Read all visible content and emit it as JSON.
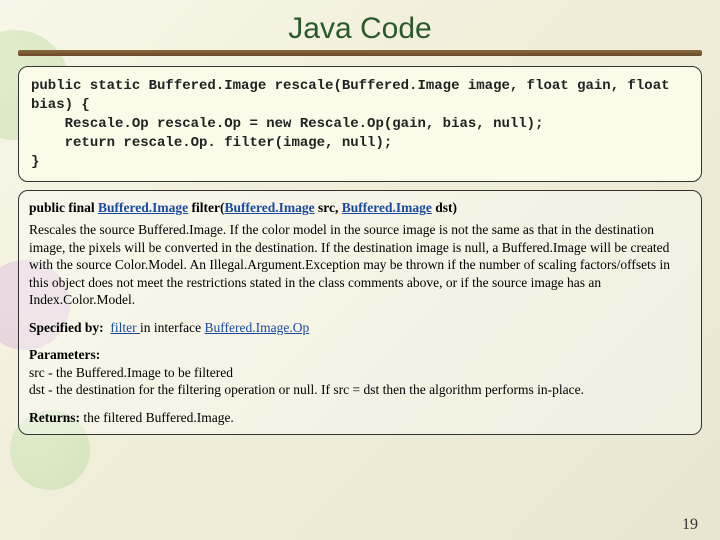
{
  "title": "Java Code",
  "code": "public static Buffered.Image rescale(Buffered.Image image, float gain, float bias) {\n    Rescale.Op rescale.Op = new Rescale.Op(gain, bias, null);\n    return rescale.Op. filter(image, null);\n}",
  "doc": {
    "sig_prefix": "public final ",
    "sig_ret": "Buffered.Image",
    "sig_mid": " filter(",
    "sig_arg1_type": "Buffered.Image",
    "sig_arg1_name": " src, ",
    "sig_arg2_type": "Buffered.Image",
    "sig_arg2_name": " dst)",
    "desc": "Rescales the source Buffered.Image. If the color model in the source image is not the same as that in the destination image, the pixels will be converted in the destination. If the destination image is null, a Buffered.Image will be created with the source Color.Model. An Illegal.Argument.Exception may be thrown if the number of scaling factors/offsets in this object does not meet the restrictions stated in the class comments above, or if the source image has an Index.Color.Model.",
    "specified_label": "Specified by:",
    "specified_link1": "filter ",
    "specified_text": "in interface ",
    "specified_link2": "Buffered.Image.Op",
    "params_label": "Parameters:",
    "param1": "src - the Buffered.Image to be filtered",
    "param2": "dst - the destination for the filtering operation or null.  If src = dst then the algorithm performs in-place.",
    "returns_label": "Returns:",
    "returns_text": " the filtered Buffered.Image."
  },
  "page_number": "19"
}
